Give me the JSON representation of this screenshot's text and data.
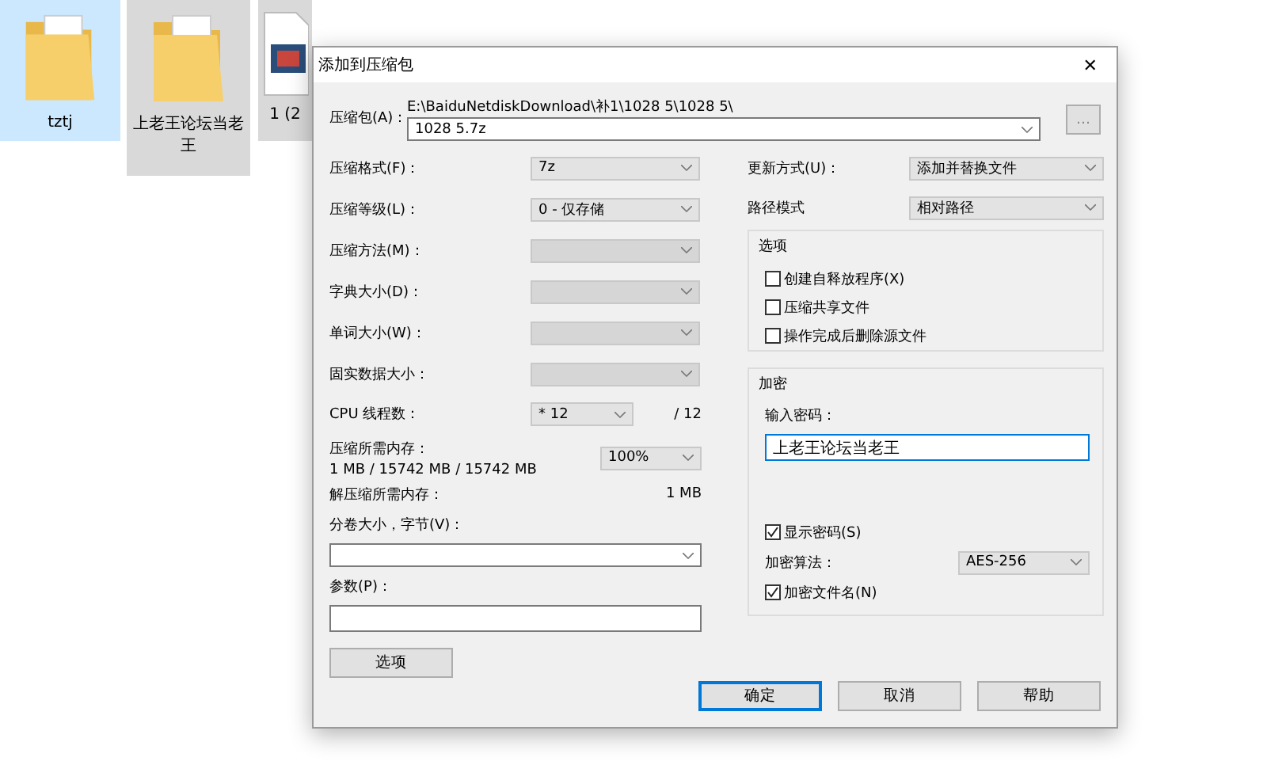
{
  "desktop_icons": [
    {
      "label": "tztj",
      "selected": true,
      "kind": "folder"
    },
    {
      "label": "上老王论坛当老王",
      "selected": false,
      "kind": "folder"
    },
    {
      "label": "1 (2",
      "selected": false,
      "kind": "video-file"
    }
  ],
  "dialog": {
    "title": "添加到压缩包",
    "close": "✕",
    "archive": {
      "label": "压缩包(A)：",
      "path": "E:\\BaiduNetdiskDownload\\补1\\1028 5\\1028 5\\",
      "value": "1028 5.7z",
      "browse": "..."
    },
    "left_rows": [
      {
        "kind": "select",
        "label": "压缩格式(F)：",
        "value": "7z",
        "disabled": false
      },
      {
        "kind": "select",
        "label": "压缩等级(L)：",
        "value": "0 - 仅存储",
        "disabled": false
      },
      {
        "kind": "select",
        "label": "压缩方法(M)：",
        "disabled": true
      },
      {
        "kind": "select",
        "label": "字典大小(D)：",
        "disabled": true
      },
      {
        "kind": "select",
        "label": "单词大小(W)：",
        "disabled": true
      },
      {
        "kind": "select",
        "label": "固实数据大小：",
        "disabled": true
      },
      {
        "kind": "cpu",
        "label": "CPU 线程数：",
        "value": "* 12",
        "total": "/ 12"
      },
      {
        "kind": "memory",
        "label": "压缩所需内存：",
        "detail": "1 MB / 15742 MB / 15742 MB",
        "value": "100%"
      },
      {
        "kind": "readout",
        "label": "解压缩所需内存：",
        "value": "1 MB"
      },
      {
        "kind": "combo",
        "label": "分卷大小，字节(V)："
      },
      {
        "kind": "input",
        "label": "参数(P)："
      }
    ],
    "options_button": "选项",
    "update": {
      "label": "更新方式(U)：",
      "value": "添加并替换文件"
    },
    "path_mode": {
      "label": "路径模式",
      "value": "相对路径"
    },
    "options_group": {
      "title": "选项",
      "checkboxes": [
        {
          "label": "创建自释放程序(X)",
          "checked": false
        },
        {
          "label": "压缩共享文件",
          "checked": false
        },
        {
          "label": "操作完成后删除源文件",
          "checked": false
        }
      ]
    },
    "encryption": {
      "title": "加密",
      "password_label": "输入密码：",
      "password": "上老王论坛当老王",
      "show_password": {
        "label": "显示密码(S)",
        "checked": true
      },
      "method_label": "加密算法：",
      "method": "AES-256",
      "encrypt_names": {
        "label": "加密文件名(N)",
        "checked": true
      }
    },
    "buttons": [
      {
        "label": "确定",
        "default": true
      },
      {
        "label": "取消",
        "default": false
      },
      {
        "label": "帮助",
        "default": false
      }
    ]
  }
}
